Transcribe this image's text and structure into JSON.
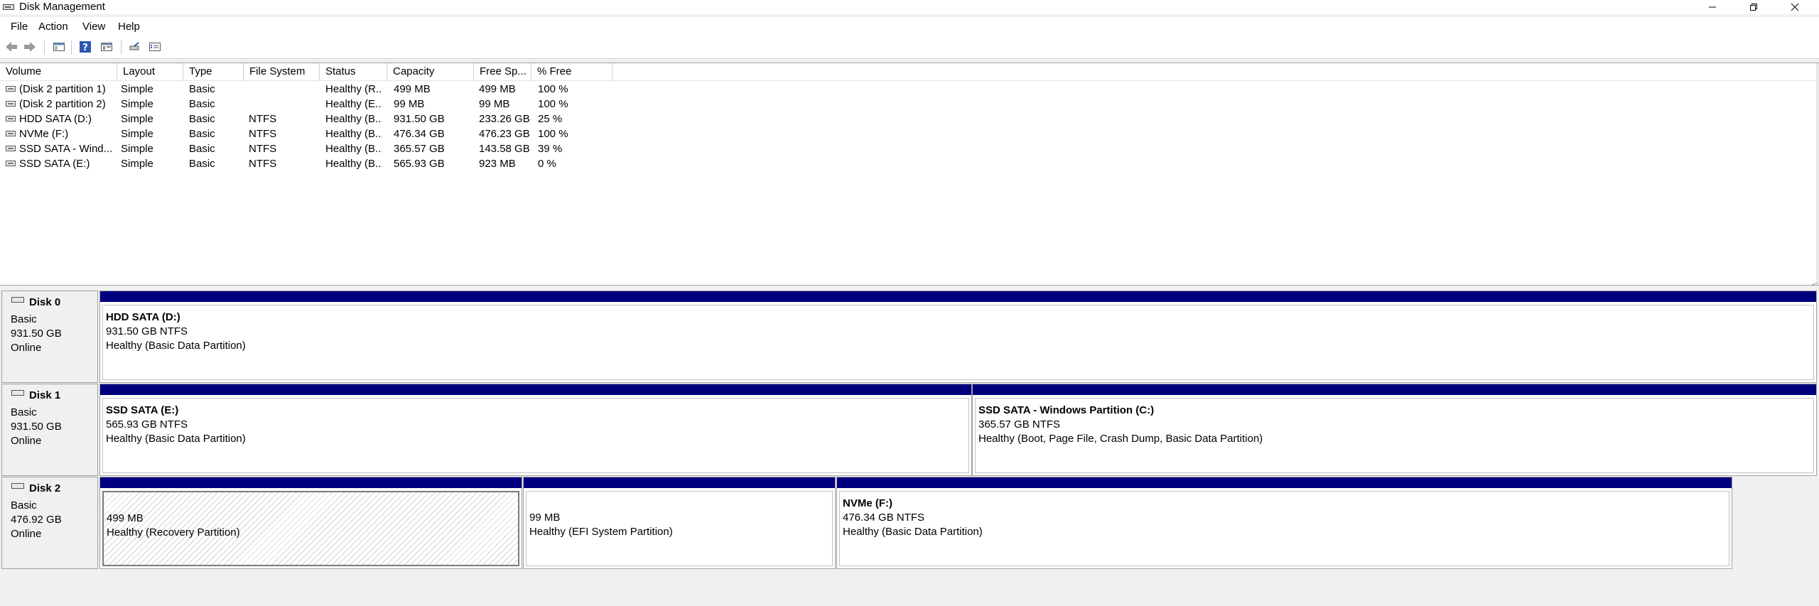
{
  "window": {
    "title": "Disk Management"
  },
  "menu": [
    "File",
    "Action",
    "View",
    "Help"
  ],
  "toolbar": {
    "icons": [
      "back-icon",
      "forward-icon",
      "console-tree-icon",
      "help-icon",
      "properties-icon",
      "connect-icon",
      "settings-list-icon"
    ]
  },
  "volume_list": {
    "columns": [
      "Volume",
      "Layout",
      "Type",
      "File System",
      "Status",
      "Capacity",
      "Free Sp...",
      "% Free"
    ],
    "rows": [
      [
        "(Disk 2 partition 1)",
        "Simple",
        "Basic",
        "",
        "Healthy (R...",
        "499 MB",
        "499 MB",
        "100 %"
      ],
      [
        "(Disk 2 partition 2)",
        "Simple",
        "Basic",
        "",
        "Healthy (E...",
        "99 MB",
        "99 MB",
        "100 %"
      ],
      [
        "HDD SATA (D:)",
        "Simple",
        "Basic",
        "NTFS",
        "Healthy (B...",
        "931.50 GB",
        "233.26 GB",
        "25 %"
      ],
      [
        "NVMe (F:)",
        "Simple",
        "Basic",
        "NTFS",
        "Healthy (B...",
        "476.34 GB",
        "476.23 GB",
        "100 %"
      ],
      [
        "SSD SATA - Wind...",
        "Simple",
        "Basic",
        "NTFS",
        "Healthy (B...",
        "365.57 GB",
        "143.58 GB",
        "39 %"
      ],
      [
        "SSD SATA (E:)",
        "Simple",
        "Basic",
        "NTFS",
        "Healthy (B...",
        "565.93 GB",
        "923 MB",
        "0 %"
      ]
    ]
  },
  "disks": [
    {
      "name": "Disk 0",
      "type": "Basic",
      "size": "931.50 GB",
      "state": "Online",
      "partitions": [
        {
          "name": "HDD SATA  (D:)",
          "size": "931.50 GB NTFS",
          "status": "Healthy (Basic Data Partition)"
        }
      ]
    },
    {
      "name": "Disk 1",
      "type": "Basic",
      "size": "931.50 GB",
      "state": "Online",
      "partitions": [
        {
          "name": "SSD SATA  (E:)",
          "size": "565.93 GB NTFS",
          "status": "Healthy (Basic Data Partition)"
        },
        {
          "name": "SSD SATA - Windows Partition  (C:)",
          "size": "365.57 GB NTFS",
          "status": "Healthy (Boot, Page File, Crash Dump, Basic Data Partition)"
        }
      ]
    },
    {
      "name": "Disk 2",
      "type": "Basic",
      "size": "476.92 GB",
      "state": "Online",
      "partitions": [
        {
          "name": "",
          "size": "499 MB",
          "status": "Healthy (Recovery Partition)"
        },
        {
          "name": "",
          "size": "99 MB",
          "status": "Healthy (EFI System Partition)"
        },
        {
          "name": "NVMe  (F:)",
          "size": "476.34 GB NTFS",
          "status": "Healthy (Basic Data Partition)"
        }
      ]
    }
  ],
  "colors": {
    "partition_bar": "#00007f",
    "window_bg": "#f0f0f0"
  }
}
